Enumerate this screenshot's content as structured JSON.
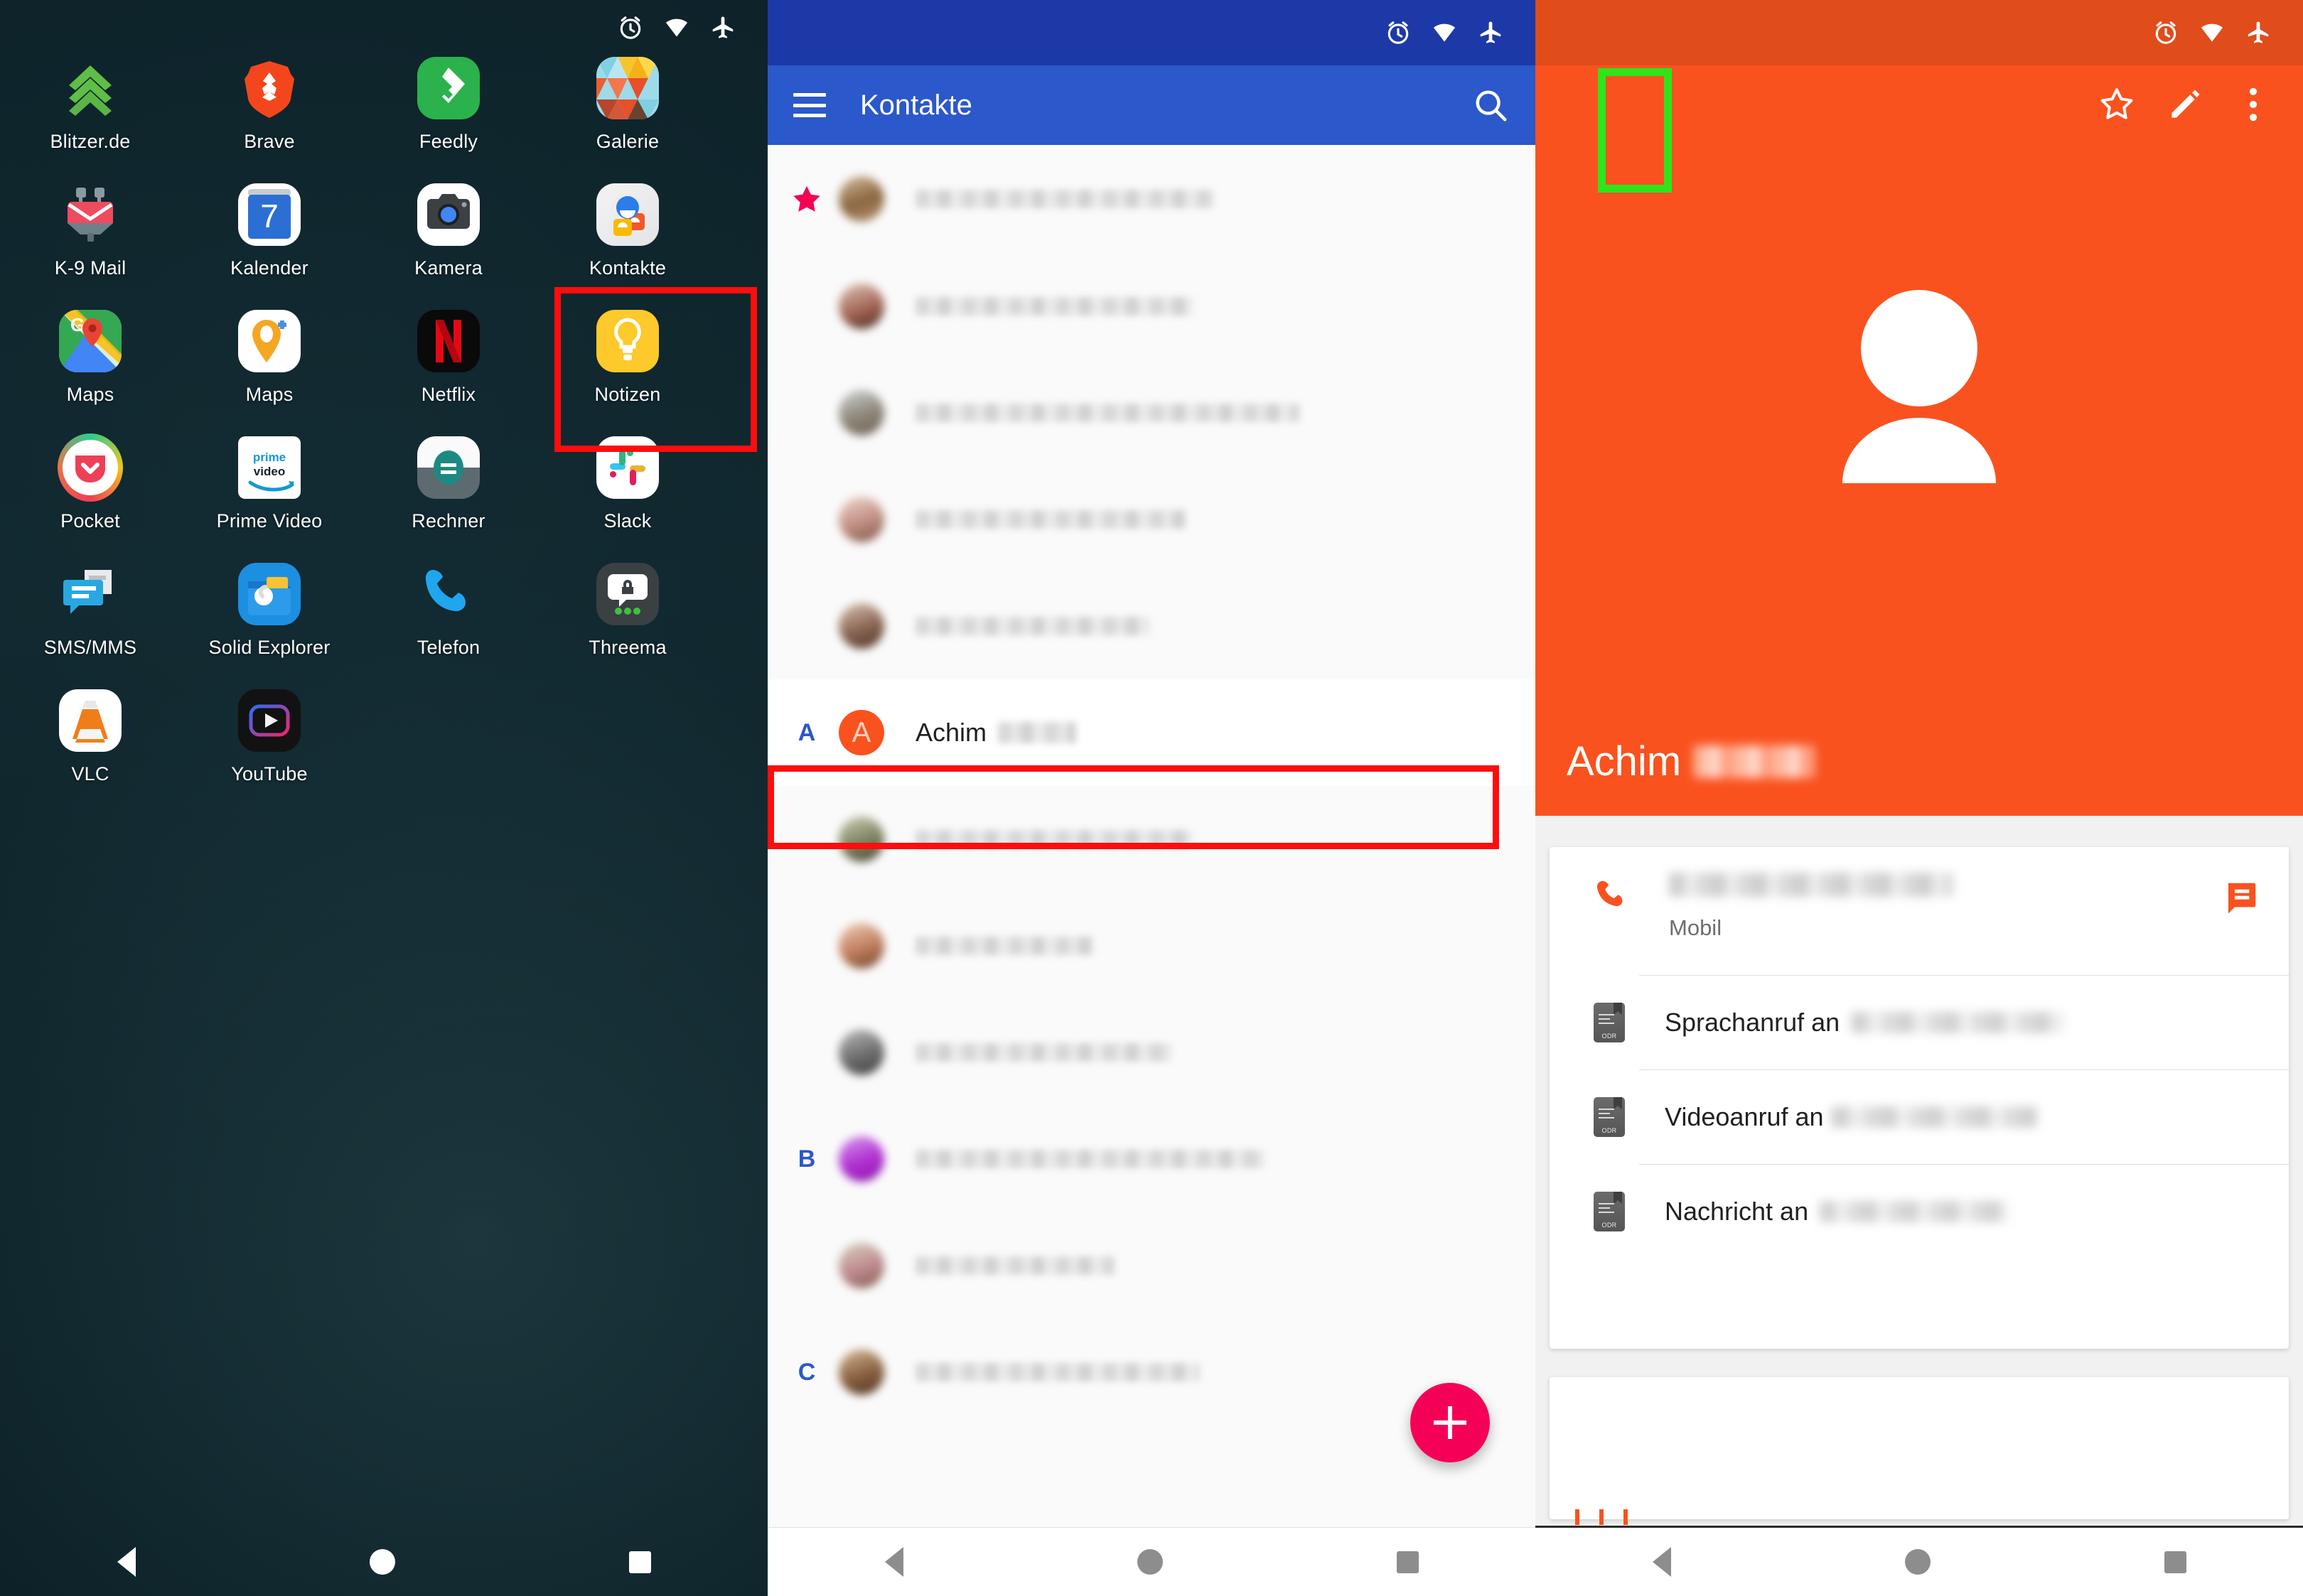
{
  "colors": {
    "launcher_bg": "#0e242a",
    "contacts_blue": "#2B58CA",
    "contacts_statusbar_blue": "#1D39A8",
    "detail_orange": "#F9521F",
    "detail_statusbar_orange": "#E04C1A",
    "fab_pink": "#F50057",
    "favorite_star_pink": "#F50057",
    "highlight_red": "#FF0D0D",
    "highlight_green": "#2EE519",
    "section_letter_blue": "#2B58CA",
    "avatar_orange": "#F9521F"
  },
  "statusbar": {
    "icons": [
      "alarm-icon",
      "wifi-icon",
      "airplane-mode-icon"
    ]
  },
  "navbar": {
    "items": [
      "back-button",
      "home-button",
      "recents-button"
    ]
  },
  "launcher": {
    "apps": [
      {
        "label": "Blitzer.de",
        "icon": "blitzer-icon"
      },
      {
        "label": "Brave",
        "icon": "brave-icon"
      },
      {
        "label": "Feedly",
        "icon": "feedly-icon"
      },
      {
        "label": "Galerie",
        "icon": "galerie-icon"
      },
      {
        "label": "K-9 Mail",
        "icon": "k9mail-icon"
      },
      {
        "label": "Kalender",
        "icon": "kalender-icon",
        "badge": "7"
      },
      {
        "label": "Kamera",
        "icon": "kamera-icon"
      },
      {
        "label": "Kontakte",
        "icon": "kontakte-icon",
        "highlighted": true
      },
      {
        "label": "Maps",
        "icon": "google-maps-icon"
      },
      {
        "label": "Maps",
        "icon": "osmand-maps-icon"
      },
      {
        "label": "Netflix",
        "icon": "netflix-icon"
      },
      {
        "label": "Notizen",
        "icon": "notizen-icon"
      },
      {
        "label": "Pocket",
        "icon": "pocket-icon"
      },
      {
        "label": "Prime Video",
        "icon": "prime-video-icon"
      },
      {
        "label": "Rechner",
        "icon": "rechner-icon"
      },
      {
        "label": "Slack",
        "icon": "slack-icon"
      },
      {
        "label": "SMS/MMS",
        "icon": "sms-mms-icon"
      },
      {
        "label": "Solid Explorer",
        "icon": "solid-explorer-icon"
      },
      {
        "label": "Telefon",
        "icon": "telefon-icon"
      },
      {
        "label": "Threema",
        "icon": "threema-icon"
      },
      {
        "label": "VLC",
        "icon": "vlc-icon"
      },
      {
        "label": "YouTube",
        "icon": "youtube-icon"
      }
    ]
  },
  "contacts": {
    "appbar": {
      "menu_icon": "hamburger-menu-icon",
      "title": "Kontakte",
      "search_icon": "search-icon"
    },
    "rows": [
      {
        "section": "star",
        "name": "",
        "redacted": true,
        "avatar": "photo",
        "avatar_color": "#9a7a5c"
      },
      {
        "section": "",
        "name": "",
        "redacted": true,
        "avatar": "photo",
        "avatar_color": "#a8705f"
      },
      {
        "section": "",
        "name": "",
        "redacted": true,
        "avatar": "photo",
        "avatar_color": "#8d8678"
      },
      {
        "section": "",
        "name": "",
        "redacted": true,
        "avatar": "photo",
        "avatar_color": "#c08f82"
      },
      {
        "section": "",
        "name": "",
        "redacted": true,
        "avatar": "photo",
        "avatar_color": "#8a6552"
      },
      {
        "section": "A",
        "name": "Achim",
        "redacted_suffix": true,
        "avatar": "initial",
        "avatar_letter": "A",
        "highlighted": true
      },
      {
        "section": "",
        "name": "",
        "redacted": true,
        "avatar": "photo",
        "avatar_color": "#7e8260"
      },
      {
        "section": "",
        "name": "",
        "redacted": true,
        "avatar": "photo",
        "avatar_color": "#c07e5f"
      },
      {
        "section": "",
        "name": "",
        "redacted": true,
        "avatar": "photo",
        "avatar_color": "#6e6e6e"
      },
      {
        "section": "B",
        "name": "",
        "redacted": true,
        "avatar": "photo",
        "avatar_color": "#b030d0"
      },
      {
        "section": "",
        "name": "",
        "redacted": true,
        "avatar": "photo",
        "avatar_color": "#c08a90"
      },
      {
        "section": "C",
        "name": "",
        "redacted": true,
        "avatar": "photo",
        "avatar_color": "#8a6040"
      }
    ],
    "fab": {
      "icon": "add-contact-icon",
      "label": "+"
    }
  },
  "detail": {
    "star_icon": "favorite-star-outline-icon",
    "edit_icon": "edit-pencil-icon",
    "overflow_icon": "overflow-menu-icon",
    "avatar_icon": "default-person-avatar-icon",
    "name": "Achim",
    "name_redacted": true,
    "phone": {
      "call_icon": "phone-call-icon",
      "number_redacted": true,
      "type_label": "Mobil",
      "message_icon": "sms-message-icon"
    },
    "actions": [
      {
        "icon": "sim-card-icon",
        "label": "Sprachanruf an",
        "target_redacted": true
      },
      {
        "icon": "sim-card-icon",
        "label": "Videoanruf an",
        "target_redacted": true
      },
      {
        "icon": "sim-card-icon",
        "label": "Nachricht an",
        "target_redacted": true
      }
    ],
    "sim_badge_text": "ODR"
  }
}
